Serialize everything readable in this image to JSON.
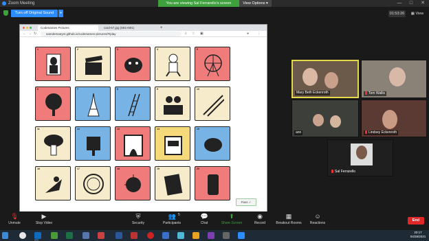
{
  "window": {
    "title": "Zoom Meeting",
    "minimize": "—",
    "maximize": "□",
    "close": "✕"
  },
  "banner": {
    "viewing": "You are viewing Sal Ferrarello's screen",
    "view_options": "View Options ▾"
  },
  "topbar": {
    "original_sound": "Turn off Original Sound",
    "timer": "01:53:26",
    "view": "View"
  },
  "browser": {
    "tabs": [
      {
        "label": "Codenames Pictures",
        "active": true
      },
      {
        "label": "card-67.jpg (591×591)",
        "active": false
      }
    ],
    "new_tab": "+",
    "url": "samdemaeyer.github.io/codenames-pictures/#/play"
  },
  "board": {
    "cards": [
      {
        "num": "1",
        "team": "red",
        "icon": "mona-lisa"
      },
      {
        "num": "2",
        "team": "neu",
        "icon": "clapperboard"
      },
      {
        "num": "3",
        "team": "red",
        "icon": "creature"
      },
      {
        "num": "4",
        "team": "neu",
        "icon": "astronaut"
      },
      {
        "num": "5",
        "team": "red",
        "icon": "ferris-wheel"
      },
      {
        "num": "6",
        "team": "red",
        "icon": "tree"
      },
      {
        "num": "7",
        "team": "blue",
        "icon": "eiffel-tower"
      },
      {
        "num": "8",
        "team": "blue",
        "icon": "ladder"
      },
      {
        "num": "9",
        "team": "neu",
        "icon": "cooks"
      },
      {
        "num": "10",
        "team": "neu",
        "icon": "railroad"
      },
      {
        "num": "11",
        "team": "neu",
        "icon": "mushroom"
      },
      {
        "num": "12",
        "team": "blue",
        "icon": "mailbox"
      },
      {
        "num": "13",
        "team": "red",
        "icon": "fireplace"
      },
      {
        "num": "14",
        "team": "yel",
        "icon": "slot-machine"
      },
      {
        "num": "15",
        "team": "blue",
        "icon": "piggy-bank"
      },
      {
        "num": "16",
        "team": "neu",
        "icon": "witch"
      },
      {
        "num": "17",
        "team": "neu",
        "icon": "hamster-wheel"
      },
      {
        "num": "18",
        "team": "red",
        "icon": "pufferfish"
      },
      {
        "num": "19",
        "team": "neu",
        "icon": "notebook"
      },
      {
        "num": "20",
        "team": "red",
        "icon": "barrel"
      }
    ],
    "pass_label": "Pass ✓"
  },
  "participants": [
    {
      "name": "Mary Beth Eckenroth",
      "active": true
    },
    {
      "name": "Tom Wallis",
      "active": false
    },
    {
      "name": "ann",
      "active": false
    },
    {
      "name": "Lindsey Eckenroth",
      "active": false
    },
    {
      "name": "Sal Ferrarello",
      "active": false
    }
  ],
  "toolbar": {
    "unmute": "Unmute",
    "stop_video": "Stop Video",
    "security": "Security",
    "participants": "Participants",
    "participant_count": "5",
    "chat": "Chat",
    "share_screen": "Share Screen",
    "record": "Record",
    "breakout": "Breakout Rooms",
    "reactions": "Reactions",
    "end": "End"
  },
  "taskbar": {
    "time": "20:17",
    "date": "04/28/2021"
  },
  "colors": {
    "red": "#f07b7b",
    "blue": "#78b3e6",
    "neutral": "#f6eccc",
    "assassin": "#f5d97a",
    "zoom_blue": "#2d8cff",
    "share_green": "#3ea13e"
  }
}
